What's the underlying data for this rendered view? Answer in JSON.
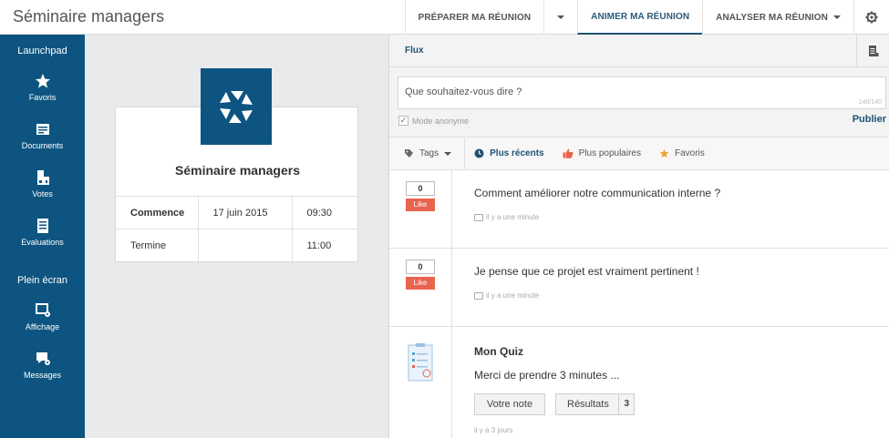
{
  "app": {
    "title": "Séminaire managers"
  },
  "topnav": {
    "items": [
      {
        "label": "PRÉPARER MA RÉUNION"
      },
      {
        "label": ""
      },
      {
        "label": "ANIMER MA RÉUNION"
      },
      {
        "label": "ANALYSER MA RÉUNION"
      }
    ],
    "settings_icon": "gear-icon"
  },
  "sidebar": {
    "section1": "Launchpad",
    "items1": [
      {
        "label": "Favoris",
        "icon": "star-icon"
      },
      {
        "label": "Documents",
        "icon": "documents-icon"
      },
      {
        "label": "Votes",
        "icon": "votes-icon"
      },
      {
        "label": "Evaluations",
        "icon": "evaluations-icon"
      }
    ],
    "section2": "Plein écran",
    "items2": [
      {
        "label": "Affichage",
        "icon": "display-icon"
      },
      {
        "label": "Messages",
        "icon": "messages-icon"
      }
    ]
  },
  "event": {
    "title": "Séminaire managers",
    "rows": [
      {
        "label": "Commence",
        "date": "17 juin 2015",
        "time": "09:30"
      },
      {
        "label": "Termine",
        "date": "",
        "time": "11:00"
      }
    ]
  },
  "flux": {
    "label": "Flux",
    "placeholder": "Que souhaitez-vous dire ?",
    "counter": "140/140",
    "anonymous_label": "Mode anonyme",
    "publish_label": "Publier"
  },
  "filters": {
    "tags": "Tags",
    "recent": "Plus récents",
    "popular": "Plus populaires",
    "favorites": "Favoris"
  },
  "posts": [
    {
      "count": "0",
      "like": "Like",
      "text": "Comment améliorer notre communication interne ?",
      "time": "il y a une minute"
    },
    {
      "count": "0",
      "like": "Like",
      "text": "Je pense que ce projet est vraiment pertinent !",
      "time": "il y a une minute"
    }
  ],
  "quiz": {
    "title": "Mon Quiz",
    "description": "Merci de prendre 3 minutes ...",
    "rate_button": "Votre note",
    "results_button": "Résultats",
    "results_count": "3",
    "time": "il y a 3 jours"
  },
  "colors": {
    "primary": "#0d5580",
    "like": "#e8644f",
    "accent": "#1e5273"
  }
}
